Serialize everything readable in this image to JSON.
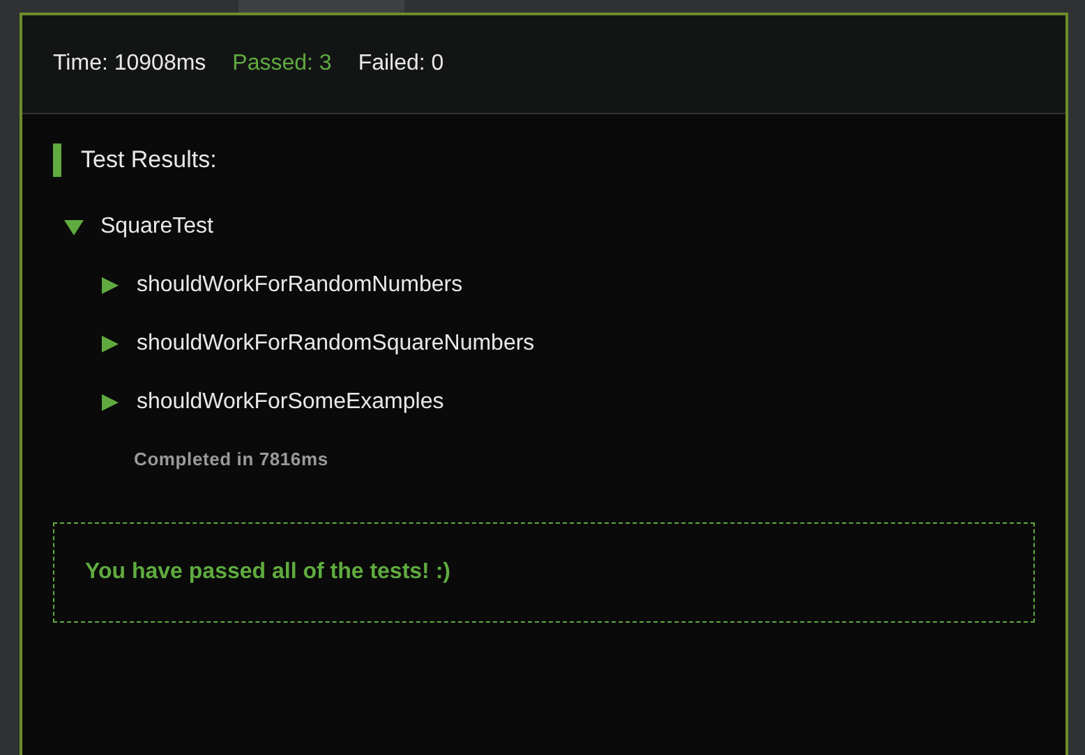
{
  "summary": {
    "time": "Time: 10908ms",
    "passed": "Passed: 3",
    "failed": "Failed: 0"
  },
  "heading": "Test Results:",
  "tree": [
    {
      "label": "SquareTest",
      "expanded": true,
      "children": [
        {
          "label": "shouldWorkForRandomNumbers",
          "expanded": false
        },
        {
          "label": "shouldWorkForRandomSquareNumbers",
          "expanded": false
        },
        {
          "label": "shouldWorkForSomeExamples",
          "expanded": false
        }
      ],
      "completed": "Completed in 7816ms"
    }
  ],
  "result_message": "You have passed all of the tests! :)"
}
